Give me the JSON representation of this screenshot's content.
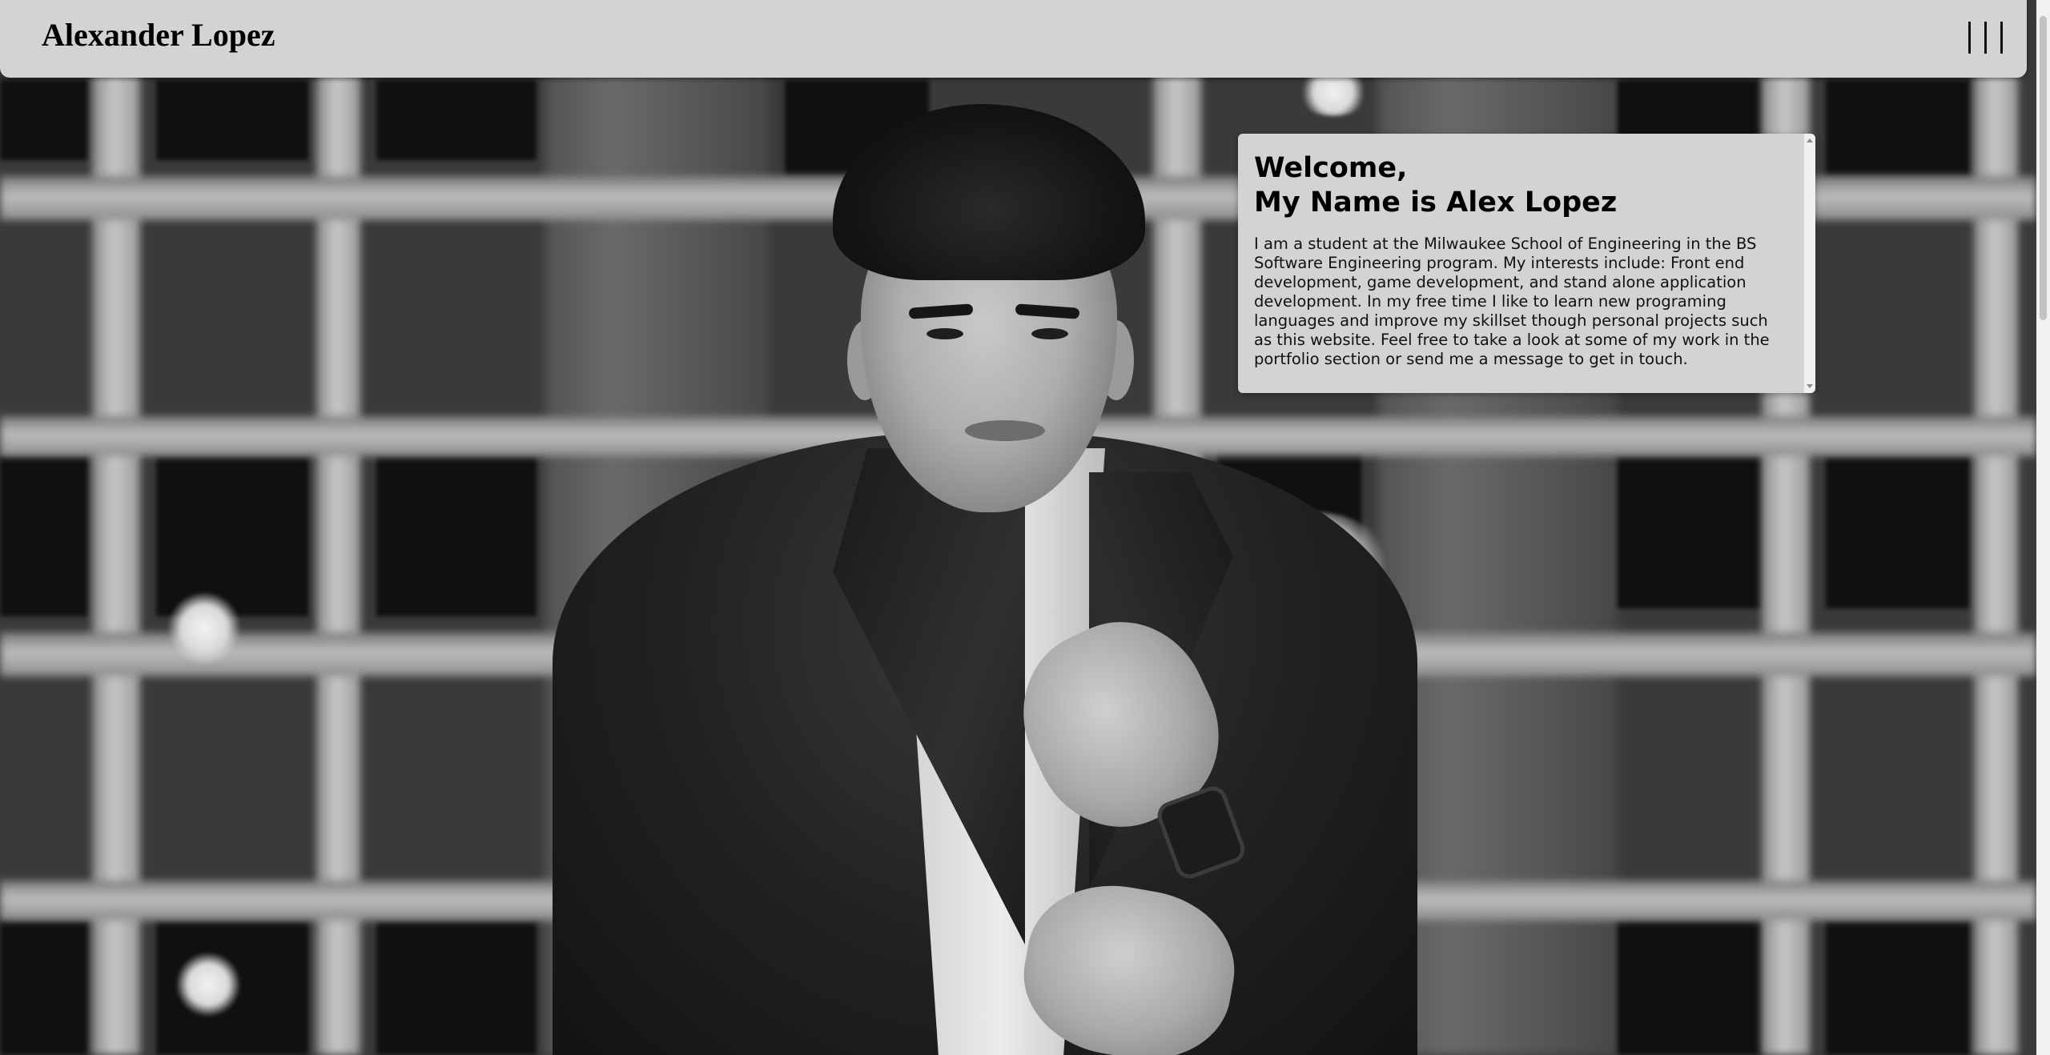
{
  "header": {
    "site_title": "Alexander Lopez",
    "menu_icon": "hamburger-vertical-bars-icon"
  },
  "hero": {
    "image_description": "black-and-white portrait photo"
  },
  "welcome": {
    "heading_line1": "Welcome,",
    "heading_line2": "My Name is Alex Lopez",
    "body": "I am a student at the Milwaukee School of Engineering in the BS Software Engineering program. My interests include: Front end development, game development, and stand alone application development. In my free time I like to learn new programing languages and improve my skillset though personal projects such as this website. Feel free to take a look at some of my work in the portfolio section or send me a message to get in touch."
  },
  "colors": {
    "header_bg": "#d3d3d3",
    "panel_bg": "#d3d3d3",
    "text": "#000000"
  }
}
